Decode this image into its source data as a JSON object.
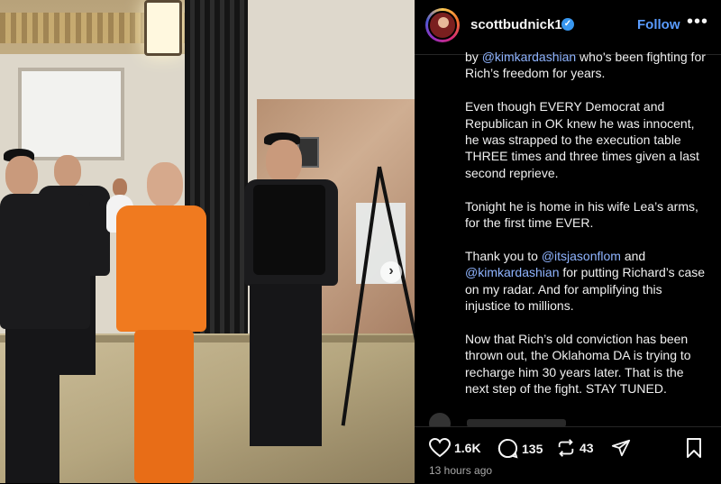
{
  "post": {
    "username": "scottbudnick1",
    "verified_icon": "verified-badge-icon",
    "follow_label": "Follow",
    "more_label": "•••",
    "caption": [
      {
        "segments": [
          {
            "text": "by ",
            "mention": false
          },
          {
            "text": "@kimkardashian",
            "mention": true
          },
          {
            "text": " who’s been fighting for Rich’s freedom for years.",
            "mention": false
          }
        ]
      },
      {
        "segments": [
          {
            "text": "Even though EVERY Democrat and Republican in OK knew he was innocent, he was strapped to the execution table THREE times and three times given a last second reprieve.",
            "mention": false
          }
        ]
      },
      {
        "segments": [
          {
            "text": "Tonight he is home in his wife Lea’s arms, for the first time EVER.",
            "mention": false
          }
        ]
      },
      {
        "segments": [
          {
            "text": "Thank you to ",
            "mention": false
          },
          {
            "text": "@itsjasonflom",
            "mention": true
          },
          {
            "text": " and ",
            "mention": false
          },
          {
            "text": "@kimkardashian",
            "mention": true
          },
          {
            "text": " for putting Richard’s case on my radar. And for amplifying this injustice to millions.",
            "mention": false
          }
        ]
      },
      {
        "segments": [
          {
            "text": "Now that Rich’s old conviction has been thrown out, the Oklahoma DA is trying to recharge him 30 years later. That is the next step of the fight. STAY TUNED.",
            "mention": false
          }
        ]
      }
    ],
    "likes": "1.6K",
    "comments": "135",
    "reposts": "43",
    "timestamp": "13 hours ago",
    "carousel_next": "›"
  },
  "colors": {
    "mention": "#8fb4ff",
    "follow": "#5a9cff",
    "background": "#000000"
  }
}
